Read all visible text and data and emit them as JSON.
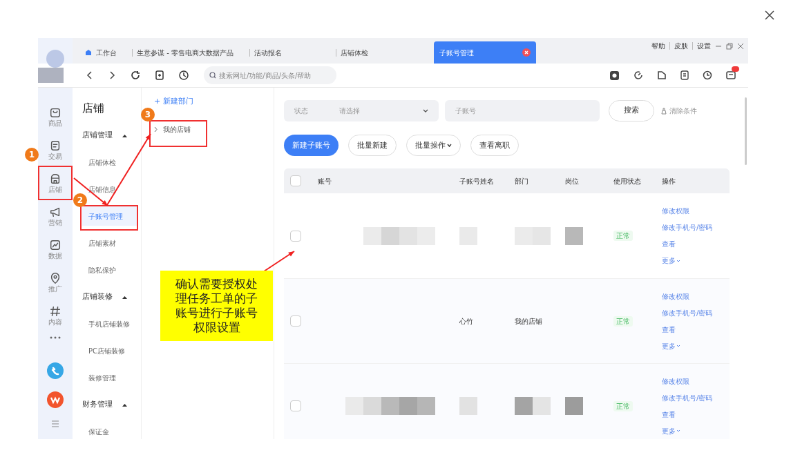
{
  "window": {
    "tabs": [
      {
        "label": "工作台",
        "selected": false,
        "kind": "home"
      },
      {
        "label": "生意参谋 - 零售电商大数据产品",
        "selected": false,
        "kind": "plain"
      },
      {
        "label": "活动报名",
        "selected": false,
        "kind": "plain"
      },
      {
        "label": "店铺体检",
        "selected": false,
        "kind": "plain"
      },
      {
        "label": "子账号管理",
        "selected": true,
        "kind": "closable"
      }
    ],
    "links": [
      "帮助",
      "皮肤",
      "设置"
    ]
  },
  "toolbar": {
    "search_placeholder": "搜索网址/功能/商品/头条/帮助"
  },
  "rail": [
    {
      "label": "商品"
    },
    {
      "label": "交易"
    },
    {
      "label": "店铺"
    },
    {
      "label": "营销"
    },
    {
      "label": "数据"
    },
    {
      "label": "推广"
    },
    {
      "label": "内容"
    }
  ],
  "menu": {
    "title": "店铺",
    "sections": [
      {
        "label": "店铺管理",
        "expanded": true,
        "items": [
          {
            "label": "店铺体检",
            "selected": false
          },
          {
            "label": "店铺信息",
            "selected": false
          },
          {
            "label": "子账号管理",
            "selected": true
          },
          {
            "label": "店铺素材",
            "selected": false
          },
          {
            "label": "隐私保护",
            "selected": false
          }
        ]
      },
      {
        "label": "店铺装修",
        "expanded": true,
        "items": [
          {
            "label": "手机店铺装修",
            "selected": false
          },
          {
            "label": "PC店铺装修",
            "selected": false
          },
          {
            "label": "装修管理",
            "selected": false
          }
        ]
      },
      {
        "label": "财务管理",
        "expanded": true,
        "items": [
          {
            "label": "保证金",
            "selected": false
          }
        ]
      }
    ]
  },
  "departments": {
    "new_label": "+ 新建部门",
    "tree": [
      {
        "label": "我的店铺",
        "expanded": false
      }
    ]
  },
  "filters": {
    "status_label": "状态",
    "status_placeholder": "请选择",
    "account_placeholder": "子账号",
    "search_button": "搜索",
    "clear_label": "清除条件"
  },
  "actions": [
    {
      "label": "新建子账号",
      "kind": "primary"
    },
    {
      "label": "批量新建",
      "kind": "default"
    },
    {
      "label": "批量操作",
      "kind": "dropdown"
    },
    {
      "label": "查看离职",
      "kind": "default"
    }
  ],
  "table": {
    "all_checked": false,
    "columns": [
      "账号",
      "子账号姓名",
      "部门",
      "岗位",
      "使用状态",
      "操作"
    ],
    "rows": [
      {
        "checked": false,
        "cells": [
          {
            "kind": "redacted"
          },
          {
            "kind": "redacted"
          },
          {
            "kind": "redacted"
          },
          {
            "kind": "redacted"
          }
        ],
        "status": "正常",
        "operations": [
          "修改权限",
          "修改手机号/密码",
          "查看",
          "更多"
        ]
      },
      {
        "checked": false,
        "cells": [
          {
            "kind": "empty"
          },
          {
            "kind": "text",
            "text": "心竹"
          },
          {
            "kind": "text",
            "text": "我的店铺"
          },
          {
            "kind": "empty"
          }
        ],
        "status": "正常",
        "operations": [
          "修改权限",
          "修改手机号/密码",
          "查看",
          "更多"
        ]
      },
      {
        "checked": false,
        "cells": [
          {
            "kind": "redacted"
          },
          {
            "kind": "redacted"
          },
          {
            "kind": "redacted"
          },
          {
            "kind": "redacted"
          }
        ],
        "status": "正常",
        "operations": [
          "修改权限",
          "修改手机号/密码",
          "查看",
          "更多"
        ]
      }
    ]
  },
  "annotations": {
    "steps": [
      "1",
      "2",
      "3"
    ],
    "callout": "确认需要授权处理任务工单的子账号进行子账号权限设置"
  }
}
